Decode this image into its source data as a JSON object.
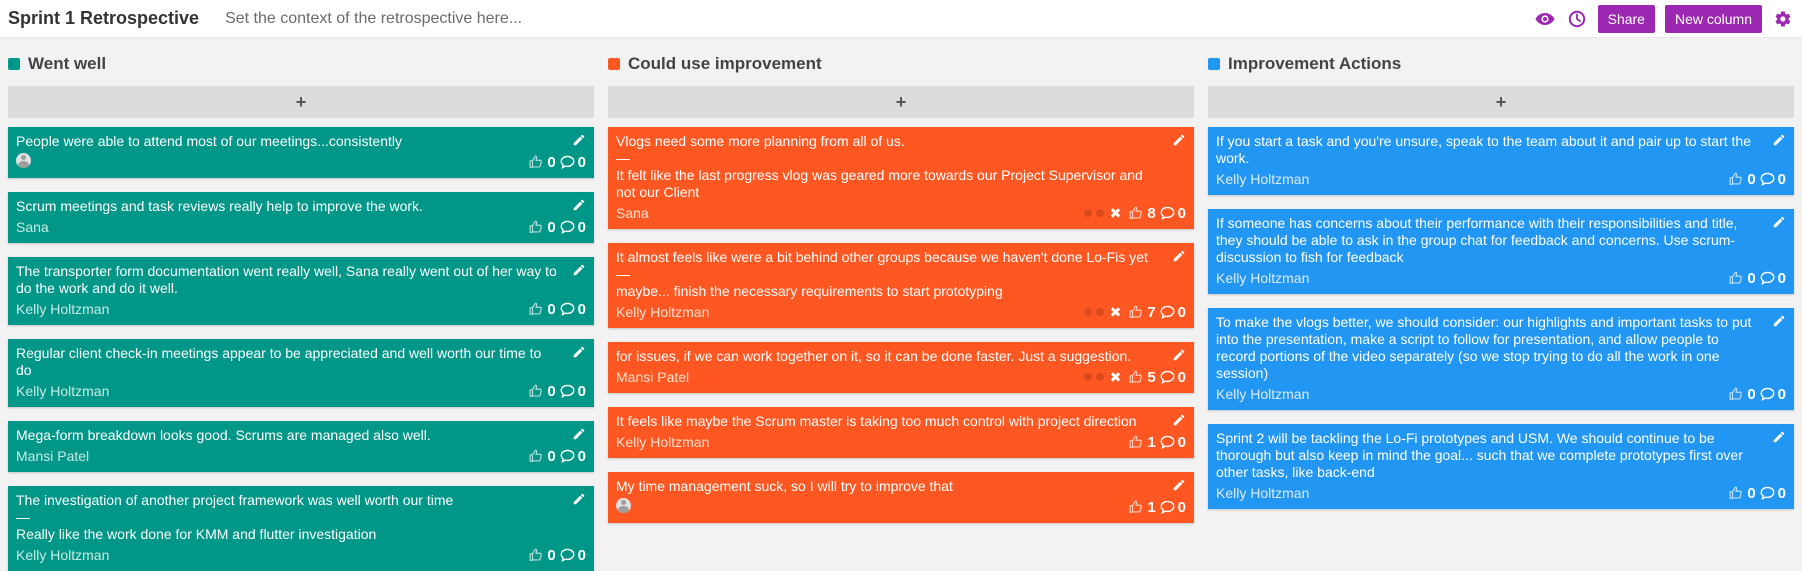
{
  "header": {
    "title": "Sprint 1 Retrospective",
    "context_placeholder": "Set the context of the retrospective here...",
    "share_label": "Share",
    "new_column_label": "New column",
    "icons": [
      "eye-icon",
      "clock-icon",
      "gear-icon"
    ],
    "accent": "#9c27b0"
  },
  "add_label": "+",
  "columns": [
    {
      "title": "Went well",
      "color": "#009688",
      "cards": [
        {
          "text": "People were able to attend most of our meetings...consistently",
          "author": "",
          "avatar": true,
          "likes": "0",
          "comments": "0"
        },
        {
          "text": "Scrum meetings and task reviews really help to improve the work.",
          "author": "Sana",
          "likes": "0",
          "comments": "0"
        },
        {
          "text": "The transporter form documentation went really well, Sana really went out of her way to do the work and do it well.",
          "author": "Kelly Holtzman",
          "likes": "0",
          "comments": "0"
        },
        {
          "text": "Regular client check-in meetings appear to be appreciated and well worth our time to do",
          "author": "Kelly Holtzman",
          "likes": "0",
          "comments": "0"
        },
        {
          "text": "Mega-form breakdown looks good. Scrums are managed also well.",
          "author": "Mansi Patel",
          "likes": "0",
          "comments": "0"
        },
        {
          "text": "The investigation of another project framework was well worth our time\n—\nReally like the work done for KMM and flutter investigation",
          "author": "Kelly Holtzman",
          "likes": "0",
          "comments": "0"
        }
      ]
    },
    {
      "title": "Could use improvement",
      "color": "#ff5722",
      "cards": [
        {
          "text": "Vlogs need some more planning from all of us.\n—\nIt felt like the last progress vlog was geared more towards our Project Supervisor and not our Client",
          "author": "Sana",
          "likes": "8",
          "comments": "0",
          "merge": true
        },
        {
          "text": "It almost feels like were a bit behind other groups because we haven't done Lo-Fis yet\n—\nmaybe... finish the necessary requirements to start prototyping",
          "author": "Kelly Holtzman",
          "likes": "7",
          "comments": "0",
          "merge": true
        },
        {
          "text": "for issues, if we can work together on it, so it can be done faster. Just a suggestion.",
          "author": "Mansi Patel",
          "likes": "5",
          "comments": "0",
          "merge": true
        },
        {
          "text": "It feels like maybe the Scrum master is taking too much control with project direction",
          "author": "Kelly Holtzman",
          "likes": "1",
          "comments": "0"
        },
        {
          "text": "My time management suck, so I will try to improve that",
          "author": "",
          "avatar": true,
          "likes": "1",
          "comments": "0"
        }
      ]
    },
    {
      "title": "Improvement Actions",
      "color": "#2196f3",
      "cards": [
        {
          "text": "If you start a task and you're unsure, speak to the team about it and pair up to start the work.",
          "author": "Kelly Holtzman",
          "likes": "0",
          "comments": "0"
        },
        {
          "text": "If someone has concerns about their performance with their responsibilities and title, they should be able to ask in the group chat for feedback and concerns. Use scrum-discussion to fish for feedback",
          "author": "Kelly Holtzman",
          "likes": "0",
          "comments": "0"
        },
        {
          "text": "To make the vlogs better, we should consider: our highlights and important tasks to put into the presentation, make a script to follow for presentation, and allow people to record portions of the video separately (so we stop trying to do all the work in one session)",
          "author": "Kelly Holtzman",
          "likes": "0",
          "comments": "0"
        },
        {
          "text": "Sprint 2 will be tackling the Lo-Fi prototypes and USM. We should continue to be thorough but also keep in mind the goal... such that we complete prototypes first over other tasks, like back-end",
          "author": "Kelly Holtzman",
          "likes": "0",
          "comments": "0"
        }
      ]
    }
  ]
}
